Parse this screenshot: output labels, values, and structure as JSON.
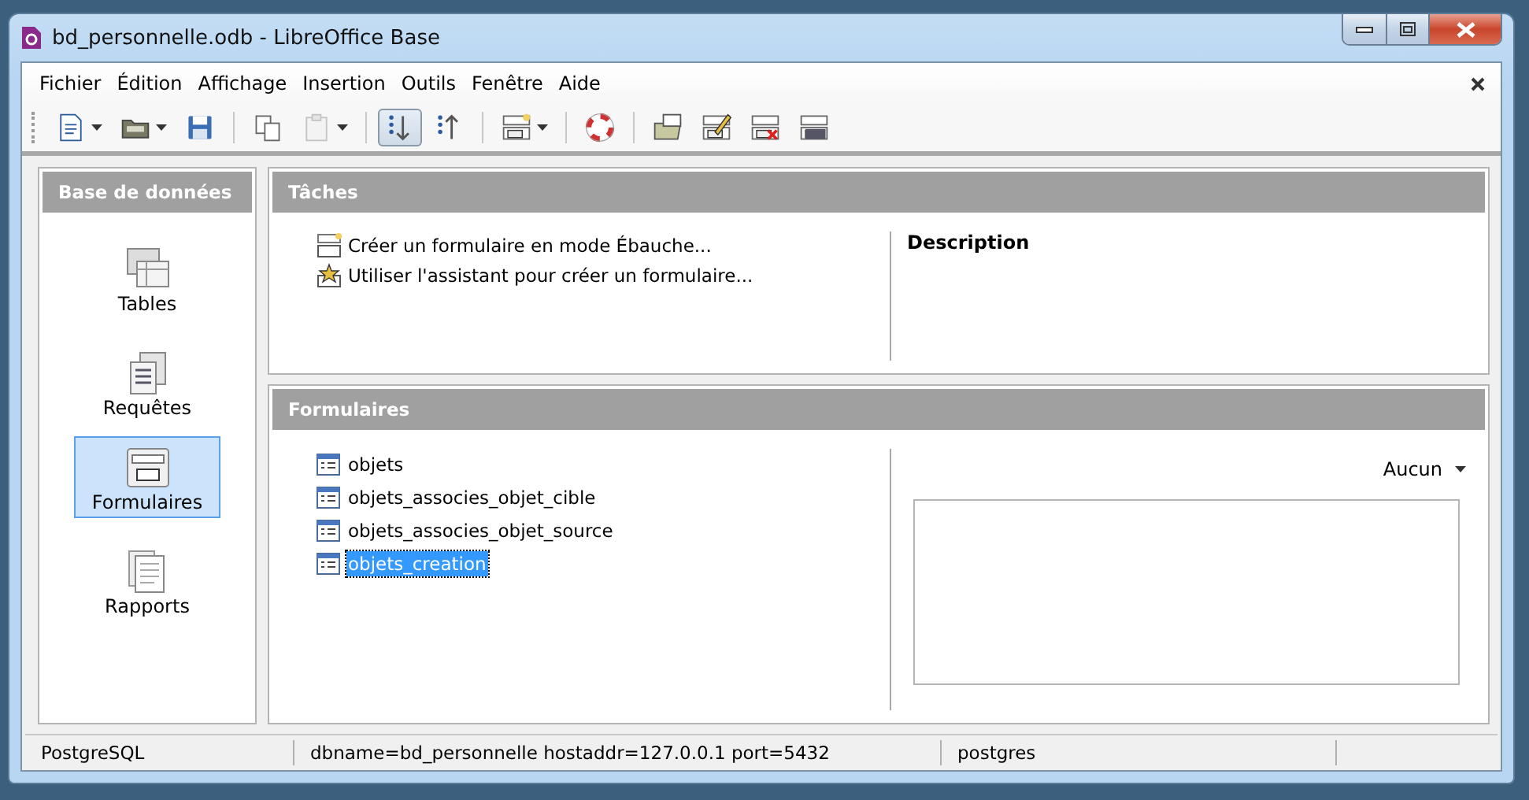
{
  "window": {
    "title": "bd_personnelle.odb - LibreOffice Base"
  },
  "menu": [
    "Fichier",
    "Édition",
    "Affichage",
    "Insertion",
    "Outils",
    "Fenêtre",
    "Aide"
  ],
  "toolbar": [
    {
      "kind": "new",
      "dropdown": true,
      "disabled": false,
      "pressed": false
    },
    {
      "kind": "open",
      "dropdown": true,
      "disabled": false,
      "pressed": false
    },
    {
      "kind": "save",
      "dropdown": false,
      "disabled": false,
      "pressed": false
    },
    {
      "kind": "sep"
    },
    {
      "kind": "copy",
      "dropdown": false,
      "disabled": false,
      "pressed": false
    },
    {
      "kind": "paste",
      "dropdown": true,
      "disabled": true,
      "pressed": false
    },
    {
      "kind": "sep"
    },
    {
      "kind": "sortdown",
      "dropdown": false,
      "disabled": false,
      "pressed": true
    },
    {
      "kind": "sortup",
      "dropdown": false,
      "disabled": false,
      "pressed": false
    },
    {
      "kind": "sep"
    },
    {
      "kind": "form",
      "dropdown": true,
      "disabled": false,
      "pressed": false
    },
    {
      "kind": "sep"
    },
    {
      "kind": "help",
      "dropdown": false,
      "disabled": false,
      "pressed": false
    },
    {
      "kind": "sep"
    },
    {
      "kind": "formopen",
      "dropdown": false,
      "disabled": false,
      "pressed": false
    },
    {
      "kind": "formedit",
      "dropdown": false,
      "disabled": false,
      "pressed": false
    },
    {
      "kind": "formdelete",
      "dropdown": false,
      "disabled": false,
      "pressed": false
    },
    {
      "kind": "formrename",
      "dropdown": false,
      "disabled": false,
      "pressed": false
    }
  ],
  "sidebar": {
    "title": "Base de données",
    "items": [
      {
        "kind": "tables",
        "label": "Tables",
        "selected": false
      },
      {
        "kind": "queries",
        "label": "Requêtes",
        "selected": false
      },
      {
        "kind": "forms",
        "label": "Formulaires",
        "selected": true
      },
      {
        "kind": "reports",
        "label": "Rapports",
        "selected": false
      }
    ]
  },
  "tasks": {
    "title": "Tâches",
    "items": [
      {
        "kind": "design",
        "label": "Créer un formulaire en mode Ébauche..."
      },
      {
        "kind": "wizard",
        "label": "Utiliser l'assistant pour créer un formulaire..."
      }
    ],
    "description_title": "Description"
  },
  "forms": {
    "title": "Formulaires",
    "items": [
      {
        "label": "objets",
        "selected": false
      },
      {
        "label": "objets_associes_objet_cible",
        "selected": false
      },
      {
        "label": "objets_associes_objet_source",
        "selected": false
      },
      {
        "label": "objets_creation",
        "selected": true
      }
    ],
    "preview": "Aucun"
  },
  "status_bar": [
    "PostgreSQL",
    "dbname=bd_personnelle hostaddr=127.0.0.1 port=5432",
    "postgres"
  ]
}
